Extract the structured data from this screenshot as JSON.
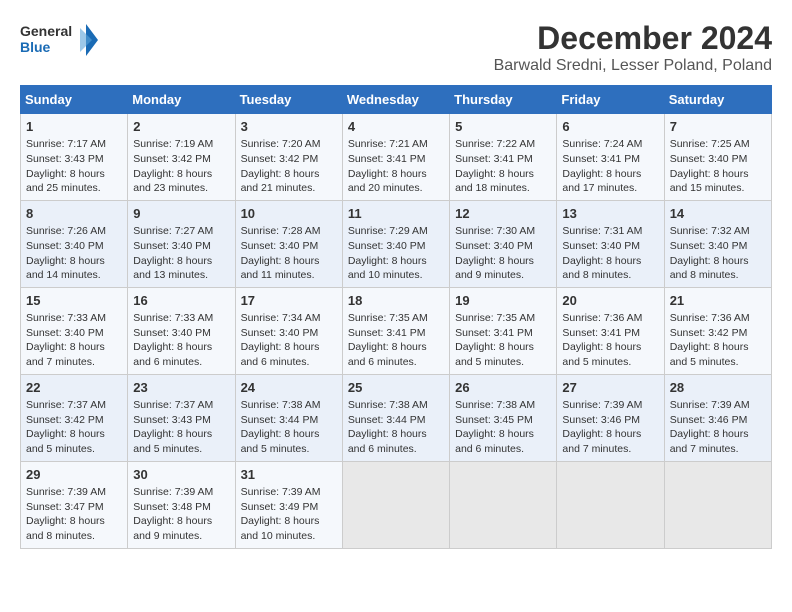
{
  "header": {
    "logo_line1": "General",
    "logo_line2": "Blue",
    "month": "December 2024",
    "location": "Barwald Sredni, Lesser Poland, Poland"
  },
  "days_of_week": [
    "Sunday",
    "Monday",
    "Tuesday",
    "Wednesday",
    "Thursday",
    "Friday",
    "Saturday"
  ],
  "weeks": [
    [
      {
        "day": "1",
        "info": "Sunrise: 7:17 AM\nSunset: 3:43 PM\nDaylight: 8 hours and 25 minutes."
      },
      {
        "day": "2",
        "info": "Sunrise: 7:19 AM\nSunset: 3:42 PM\nDaylight: 8 hours and 23 minutes."
      },
      {
        "day": "3",
        "info": "Sunrise: 7:20 AM\nSunset: 3:42 PM\nDaylight: 8 hours and 21 minutes."
      },
      {
        "day": "4",
        "info": "Sunrise: 7:21 AM\nSunset: 3:41 PM\nDaylight: 8 hours and 20 minutes."
      },
      {
        "day": "5",
        "info": "Sunrise: 7:22 AM\nSunset: 3:41 PM\nDaylight: 8 hours and 18 minutes."
      },
      {
        "day": "6",
        "info": "Sunrise: 7:24 AM\nSunset: 3:41 PM\nDaylight: 8 hours and 17 minutes."
      },
      {
        "day": "7",
        "info": "Sunrise: 7:25 AM\nSunset: 3:40 PM\nDaylight: 8 hours and 15 minutes."
      }
    ],
    [
      {
        "day": "8",
        "info": "Sunrise: 7:26 AM\nSunset: 3:40 PM\nDaylight: 8 hours and 14 minutes."
      },
      {
        "day": "9",
        "info": "Sunrise: 7:27 AM\nSunset: 3:40 PM\nDaylight: 8 hours and 13 minutes."
      },
      {
        "day": "10",
        "info": "Sunrise: 7:28 AM\nSunset: 3:40 PM\nDaylight: 8 hours and 11 minutes."
      },
      {
        "day": "11",
        "info": "Sunrise: 7:29 AM\nSunset: 3:40 PM\nDaylight: 8 hours and 10 minutes."
      },
      {
        "day": "12",
        "info": "Sunrise: 7:30 AM\nSunset: 3:40 PM\nDaylight: 8 hours and 9 minutes."
      },
      {
        "day": "13",
        "info": "Sunrise: 7:31 AM\nSunset: 3:40 PM\nDaylight: 8 hours and 8 minutes."
      },
      {
        "day": "14",
        "info": "Sunrise: 7:32 AM\nSunset: 3:40 PM\nDaylight: 8 hours and 8 minutes."
      }
    ],
    [
      {
        "day": "15",
        "info": "Sunrise: 7:33 AM\nSunset: 3:40 PM\nDaylight: 8 hours and 7 minutes."
      },
      {
        "day": "16",
        "info": "Sunrise: 7:33 AM\nSunset: 3:40 PM\nDaylight: 8 hours and 6 minutes."
      },
      {
        "day": "17",
        "info": "Sunrise: 7:34 AM\nSunset: 3:40 PM\nDaylight: 8 hours and 6 minutes."
      },
      {
        "day": "18",
        "info": "Sunrise: 7:35 AM\nSunset: 3:41 PM\nDaylight: 8 hours and 6 minutes."
      },
      {
        "day": "19",
        "info": "Sunrise: 7:35 AM\nSunset: 3:41 PM\nDaylight: 8 hours and 5 minutes."
      },
      {
        "day": "20",
        "info": "Sunrise: 7:36 AM\nSunset: 3:41 PM\nDaylight: 8 hours and 5 minutes."
      },
      {
        "day": "21",
        "info": "Sunrise: 7:36 AM\nSunset: 3:42 PM\nDaylight: 8 hours and 5 minutes."
      }
    ],
    [
      {
        "day": "22",
        "info": "Sunrise: 7:37 AM\nSunset: 3:42 PM\nDaylight: 8 hours and 5 minutes."
      },
      {
        "day": "23",
        "info": "Sunrise: 7:37 AM\nSunset: 3:43 PM\nDaylight: 8 hours and 5 minutes."
      },
      {
        "day": "24",
        "info": "Sunrise: 7:38 AM\nSunset: 3:44 PM\nDaylight: 8 hours and 5 minutes."
      },
      {
        "day": "25",
        "info": "Sunrise: 7:38 AM\nSunset: 3:44 PM\nDaylight: 8 hours and 6 minutes."
      },
      {
        "day": "26",
        "info": "Sunrise: 7:38 AM\nSunset: 3:45 PM\nDaylight: 8 hours and 6 minutes."
      },
      {
        "day": "27",
        "info": "Sunrise: 7:39 AM\nSunset: 3:46 PM\nDaylight: 8 hours and 7 minutes."
      },
      {
        "day": "28",
        "info": "Sunrise: 7:39 AM\nSunset: 3:46 PM\nDaylight: 8 hours and 7 minutes."
      }
    ],
    [
      {
        "day": "29",
        "info": "Sunrise: 7:39 AM\nSunset: 3:47 PM\nDaylight: 8 hours and 8 minutes."
      },
      {
        "day": "30",
        "info": "Sunrise: 7:39 AM\nSunset: 3:48 PM\nDaylight: 8 hours and 9 minutes."
      },
      {
        "day": "31",
        "info": "Sunrise: 7:39 AM\nSunset: 3:49 PM\nDaylight: 8 hours and 10 minutes."
      },
      {
        "day": "",
        "info": ""
      },
      {
        "day": "",
        "info": ""
      },
      {
        "day": "",
        "info": ""
      },
      {
        "day": "",
        "info": ""
      }
    ]
  ]
}
